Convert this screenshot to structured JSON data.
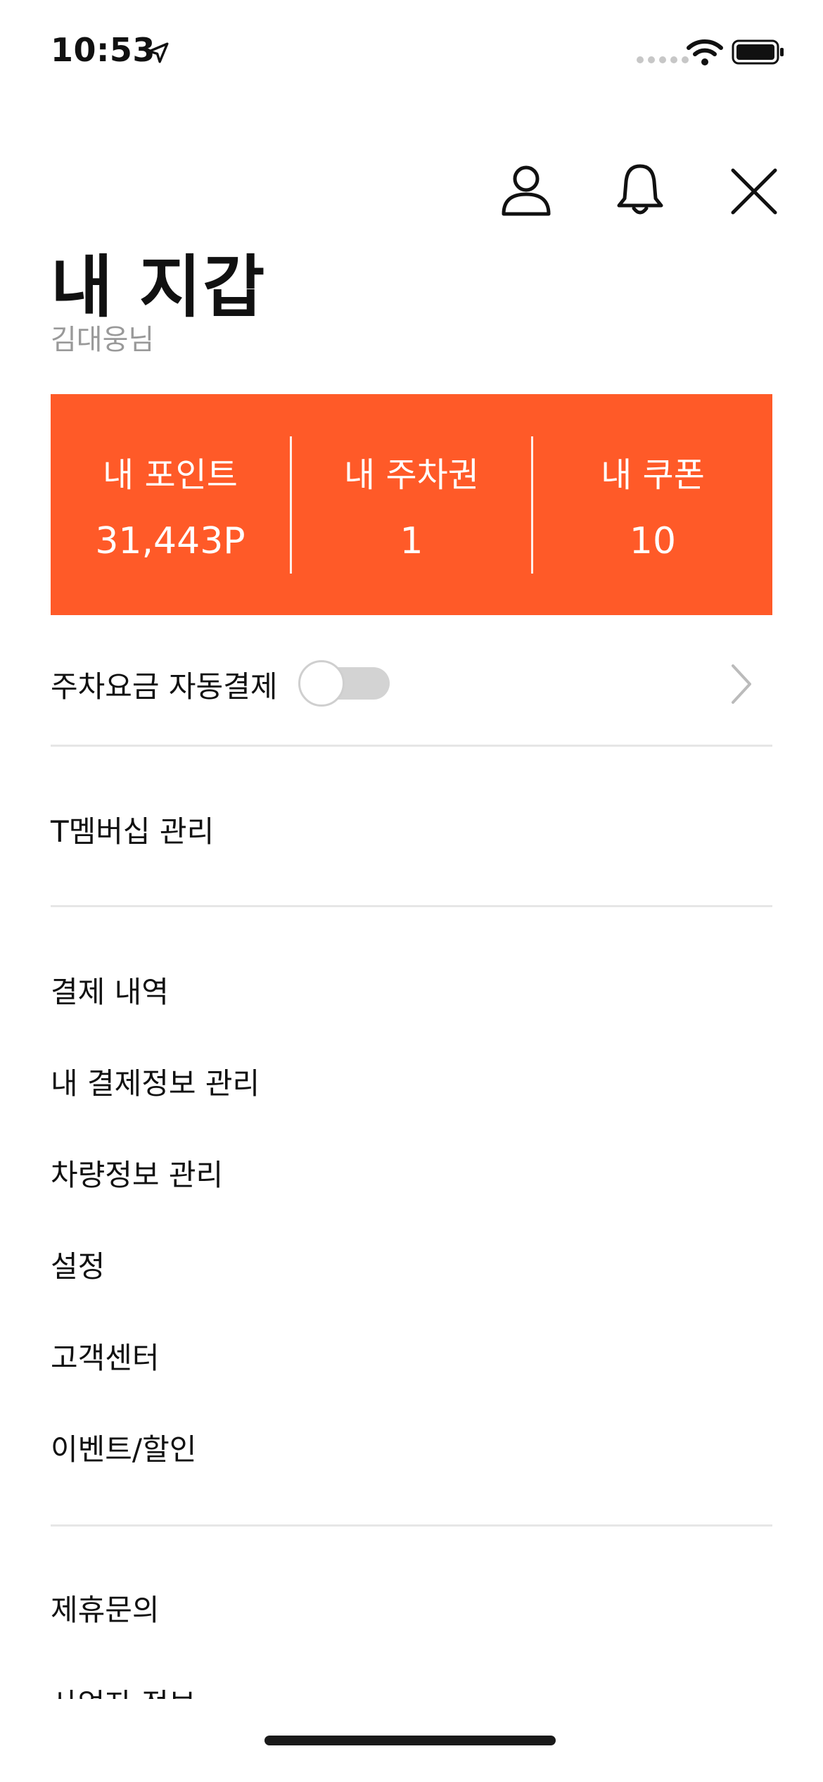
{
  "status_bar": {
    "time": "10:53"
  },
  "header": {
    "title": "내 지갑",
    "user_name": "김대웅님"
  },
  "wallet": {
    "accent": "#ff5a28",
    "stats": [
      {
        "label": "내 포인트",
        "value": "31,443P"
      },
      {
        "label": "내 주차권",
        "value": "1"
      },
      {
        "label": "내 쿠폰",
        "value": "10"
      }
    ]
  },
  "autopay": {
    "label": "주차요금 자동결제",
    "enabled": false
  },
  "menu": {
    "membership": "T멤버십 관리",
    "payment_history": "결제 내역",
    "payment_info": "내 결제정보 관리",
    "vehicle_info": "차량정보 관리",
    "settings": "설정",
    "customer_center": "고객센터",
    "events": "이벤트/할인",
    "partnership": "제휴문의",
    "business_info": "사업자 정보"
  }
}
